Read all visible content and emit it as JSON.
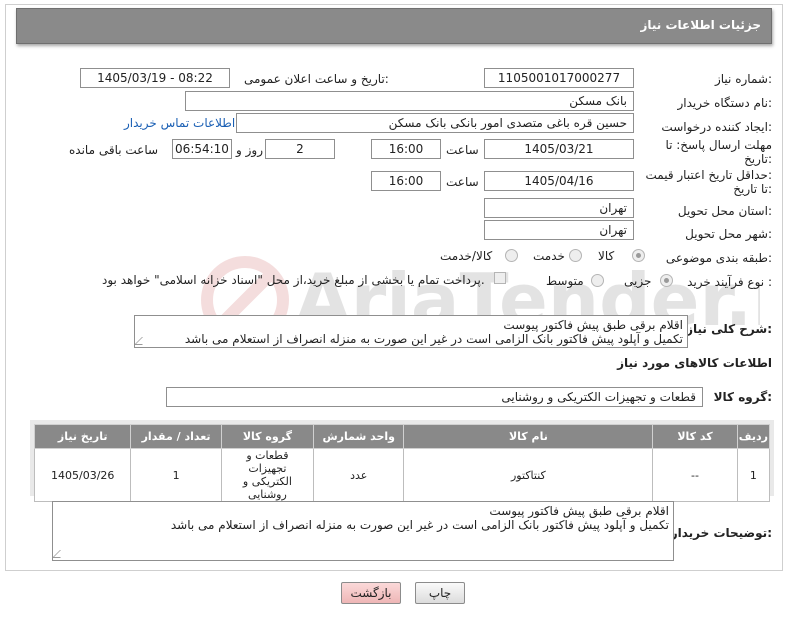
{
  "header": {
    "title": "جزئیات اطلاعات نیاز"
  },
  "need_number": {
    "label": "شماره نیاز:",
    "value": "1105001017000277"
  },
  "announce": {
    "label": "تاریخ و ساعت اعلان عمومی:",
    "value": "1405/03/19 - 08:22"
  },
  "buyer_org": {
    "label": "نام دستگاه خریدار:",
    "value": "بانک مسکن"
  },
  "creator": {
    "label": "ایجاد کننده درخواست:",
    "value": "حسین  قره باغی متصدی امور بانکی بانک مسکن",
    "contact_link": "اطلاعات تماس خریدار"
  },
  "reply_deadline": {
    "label_line1": "مهلت ارسال پاسخ: تا",
    "label_line2": "تاریخ:",
    "date": "1405/03/21",
    "time_label": "ساعت",
    "time": "16:00",
    "days": "2",
    "days_label": "روز و",
    "remaining": "06:54:10",
    "remaining_label": "ساعت باقی مانده"
  },
  "price_validity": {
    "label_line1": "حداقل تاریخ اعتبار قیمت:",
    "label_line2": "تا تاریخ:",
    "date": "1405/04/16",
    "time_label": "ساعت",
    "time": "16:00"
  },
  "province": {
    "label": "استان محل تحویل:",
    "value": "تهران"
  },
  "city": {
    "label": "شهر محل تحویل:",
    "value": "تهران"
  },
  "category": {
    "label": "طبقه بندی موضوعی:",
    "options": [
      "کالا",
      "خدمت",
      "کالا/خدمت"
    ],
    "selected": "کالا"
  },
  "purchase_type": {
    "label": "نوع فرآیند خرید :",
    "options": [
      "جزیی",
      "متوسط"
    ],
    "selected": "جزیی",
    "payment_note": "پرداخت تمام یا بخشی از مبلغ خرید،از محل \"اسناد خزانه اسلامی\" خواهد بود."
  },
  "description": {
    "label": "شرح کلی نیاز:",
    "lines": [
      "اقلام برقی طبق پیش فاکتور پیوست",
      "تکمیل و آپلود پیش فاکتور بانک الزامی است در غیر این صورت به منزله انصراف از استعلام می باشد"
    ]
  },
  "goods_section": {
    "title": "اطلاعات کالاهای مورد نیاز"
  },
  "goods_group": {
    "label": "گروه کالا:",
    "value": "قطعات و تجهیزات الکتریکی و روشنایی"
  },
  "table": {
    "headers": [
      "ردیف",
      "کد کالا",
      "نام کالا",
      "واحد شمارش",
      "گروه کالا",
      "تعداد / مقدار",
      "تاریخ نیاز"
    ],
    "rows": [
      {
        "row": "1",
        "code": "--",
        "name": "کنتاکتور",
        "unit": "عدد",
        "group": "قطعات و تجهیزات الکتریکی و روشنایی",
        "qty": "1",
        "date": "1405/03/26"
      }
    ]
  },
  "buyer_notes": {
    "label": "توضیحات خریدار:",
    "lines": [
      "اقلام برقی طبق پیش فاکتور پیوست",
      "تکمیل و آپلود پیش فاکتور بانک الزامی است در غیر این صورت به منزله انصراف از استعلام می باشد"
    ]
  },
  "buttons": {
    "print": "چاپ",
    "back": "بازگشت"
  },
  "watermark": {
    "text": "AriaTender.neT"
  },
  "colors": {
    "header_bg": "#8a8a8a",
    "link": "#1a5fb4",
    "back_button": "#f4c6c6"
  }
}
